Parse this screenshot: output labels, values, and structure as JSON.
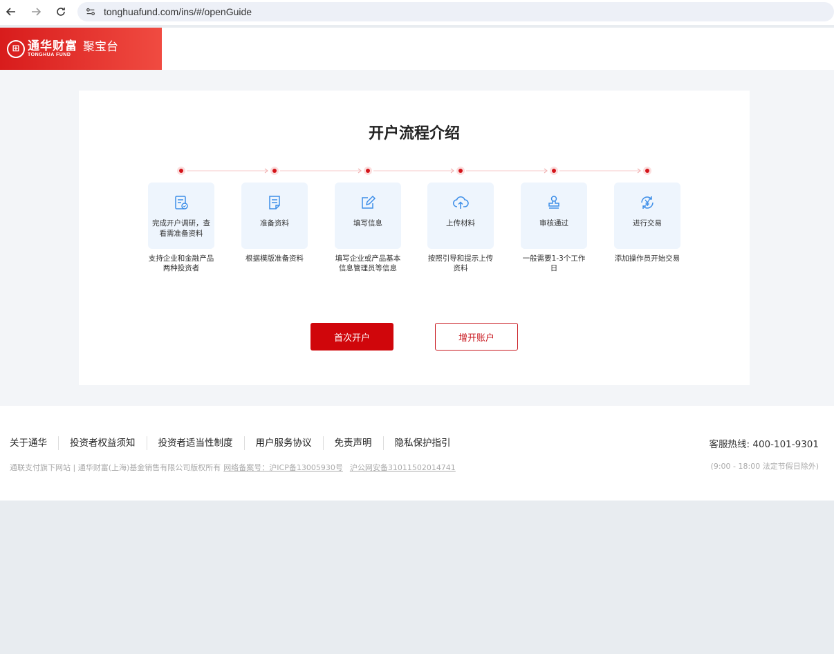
{
  "browser": {
    "url": "tonghuafund.com/ins/#/openGuide"
  },
  "header": {
    "logo_cn": "通华财富",
    "logo_en": "TONGHUA FUND",
    "logo_sub": "聚宝台"
  },
  "main": {
    "title": "开户流程介绍",
    "steps": [
      {
        "label": "完成开户调研，查看需准备资料",
        "desc": "支持企业和金融产品两种投资者",
        "icon": "checklist-icon"
      },
      {
        "label": "准备资料",
        "desc": "根据模版准备资料",
        "icon": "document-icon"
      },
      {
        "label": "填写信息",
        "desc": "填写企业或产品基本信息管理员等信息",
        "icon": "edit-icon"
      },
      {
        "label": "上传材料",
        "desc": "按照引导和提示上传资料",
        "icon": "cloud-upload-icon"
      },
      {
        "label": "审核通过",
        "desc": "一般需要1-3个工作日",
        "icon": "stamp-icon"
      },
      {
        "label": "进行交易",
        "desc": "添加操作员开始交易",
        "icon": "yuan-exchange-icon"
      }
    ],
    "primary_button": "首次开户",
    "secondary_button": "增开账户"
  },
  "footer": {
    "links": [
      "关于通华",
      "投资者权益须知",
      "投资者适当性制度",
      "用户服务协议",
      "免责声明",
      "隐私保护指引"
    ],
    "hotline": "客服热线: 400-101-9301",
    "copyright": "通联支付旗下网站 | 通华财富(上海)基金销售有限公司版权所有",
    "icp": "网络备案号：沪ICP备13005930号",
    "police": "沪公网安备31011502014741",
    "hours": "(9:00 - 18:00 法定节假日除外)"
  },
  "colors": {
    "brand_red": "#d0060b",
    "step_bg": "#eef5fd",
    "icon_blue": "#3d8ee8"
  }
}
